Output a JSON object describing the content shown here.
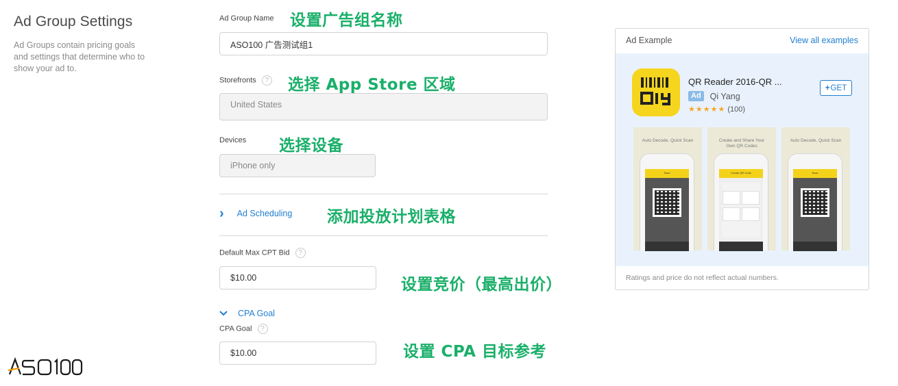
{
  "section": {
    "title": "Ad Group Settings",
    "description": "Ad Groups contain pricing goals and settings that determine who to show your ad to."
  },
  "form": {
    "ad_group_name": {
      "label": "Ad Group Name",
      "value": "ASO100 广告测试组1"
    },
    "storefronts": {
      "label": "Storefronts",
      "value": "United States"
    },
    "devices": {
      "label": "Devices",
      "value": "iPhone only"
    },
    "ad_scheduling": {
      "label": "Ad Scheduling"
    },
    "default_max_cpt_bid": {
      "label": "Default Max CPT Bid",
      "value": "$10.00"
    },
    "cpa_goal_toggle": {
      "label": "CPA Goal"
    },
    "cpa_goal": {
      "label": "CPA Goal",
      "value": "$10.00"
    },
    "help_glyph": "?"
  },
  "annotations": {
    "name": "设置广告组名称",
    "storefront": "选择 App Store 区域",
    "devices": "选择设备",
    "scheduling": "添加投放计划表格",
    "bid": "设置竞价（最高出价）",
    "cpa": "设置 CPA 目标参考"
  },
  "ad_example": {
    "title": "Ad Example",
    "view_all": "View all examples",
    "app_name": "QR Reader 2016-QR ...",
    "ad_badge": "Ad",
    "developer": "Qi Yang",
    "stars": "★★★★★",
    "rating_count": "(100)",
    "get_label": "GET",
    "get_plus": "+",
    "footer": "Ratings and price do not reflect actual numbers.",
    "screenshots": [
      {
        "caption": "Auto Decode, Quick Scan",
        "bar": "Scan"
      },
      {
        "caption": "Create and Share Your Own QR Codes",
        "bar": "Create QR Code"
      },
      {
        "caption": "Auto Decode, Quick Scan",
        "bar": "Scan"
      }
    ]
  },
  "logo": {
    "text": "ASO100"
  },
  "colors": {
    "accent": "#1f7ed0",
    "annotation": "#1aaf6a",
    "app_icon": "#f5d51e",
    "preview_bg": "#e9f2fc"
  },
  "icons": {
    "chevron_right": "›",
    "chevron_down": "⌄"
  }
}
